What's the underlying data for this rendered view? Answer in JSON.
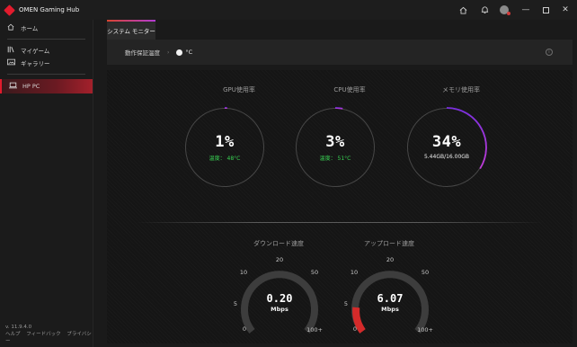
{
  "app": {
    "title": "OMEN Gaming Hub"
  },
  "titlebar": {
    "icons": [
      "home-icon",
      "bell-icon",
      "avatar",
      "minimize-icon",
      "maximize-icon",
      "close-icon"
    ]
  },
  "sidebar": {
    "items": [
      {
        "label": "ホーム",
        "icon": "home-icon"
      },
      {
        "label": "マイゲーム",
        "icon": "library-icon"
      },
      {
        "label": "ギャラリー",
        "icon": "gallery-icon"
      },
      {
        "label": "HP PC",
        "icon": "laptop-icon"
      }
    ],
    "version": "v. 11.9.4.0",
    "footer_links": [
      "ヘルプ",
      "フィードバック",
      "プライバシー"
    ]
  },
  "tab": {
    "label": "システム モニター"
  },
  "toolbar": {
    "label": "動作保証温度",
    "unit": "°C"
  },
  "gauges": [
    {
      "title": "GPU使用率",
      "percent": "1%",
      "detail": "温度： 48°C",
      "value": 1
    },
    {
      "title": "CPU使用率",
      "percent": "3%",
      "detail": "温度： 51°C",
      "value": 3
    },
    {
      "title": "メモリ使用率",
      "percent": "34%",
      "detail": "5.44GB/16.00GB",
      "value": 34
    }
  ],
  "speeds": [
    {
      "title": "ダウンロード速度",
      "value": "0.20",
      "unit": "Mbps",
      "ticks": [
        "0",
        "5",
        "10",
        "20",
        "50",
        "100+"
      ]
    },
    {
      "title": "アップロード速度",
      "value": "6.07",
      "unit": "Mbps",
      "ticks": [
        "0",
        "5",
        "10",
        "20",
        "50",
        "100+"
      ]
    }
  ]
}
